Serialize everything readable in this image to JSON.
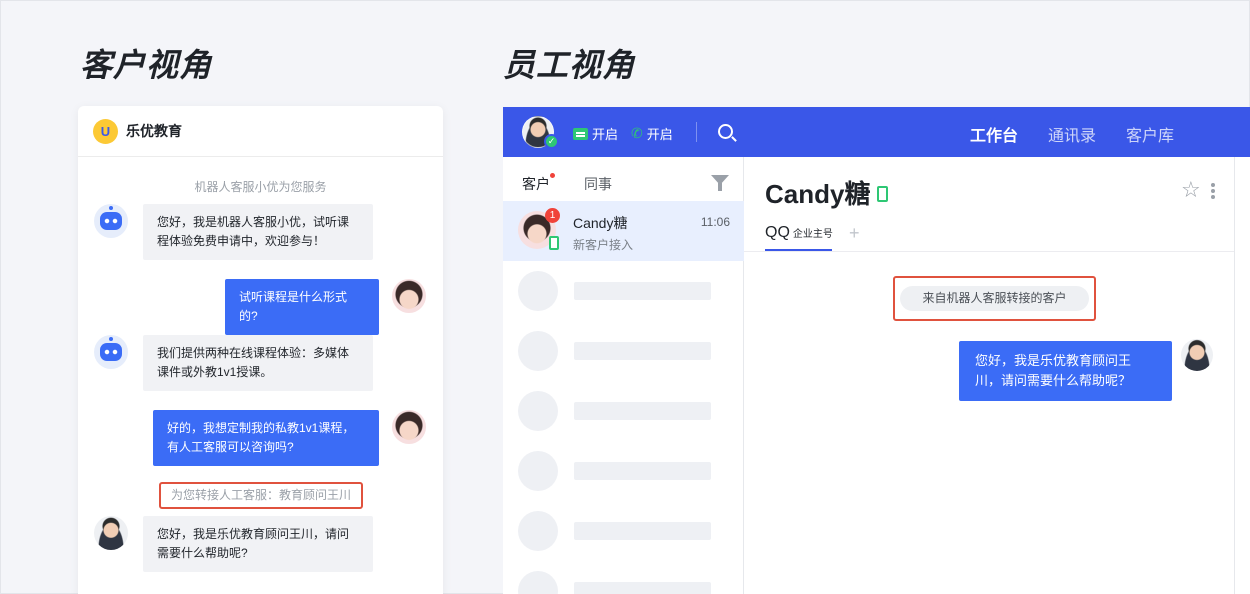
{
  "titles": {
    "customer_view": "客户视角",
    "staff_view": "员工视角"
  },
  "customer": {
    "brand_logo": "U",
    "brand_name": "乐优教育",
    "service_note": "机器人客服小优为您服务",
    "messages": [
      {
        "side": "left",
        "avatar": "robot-icon",
        "text": "您好，我是机器人客服小优，试听课程体验免费申请中，欢迎参与！"
      },
      {
        "side": "right",
        "avatar": "customer-avatar",
        "text": "试听课程是什么形式的?"
      },
      {
        "side": "left",
        "avatar": "robot-icon",
        "text": "我们提供两种在线课程体验：多媒体课件或外教1v1授课。"
      },
      {
        "side": "right",
        "avatar": "customer-avatar",
        "text": "好的，我想定制我的私教1v1课程，有人工客服可以咨询吗?"
      },
      {
        "side": "left",
        "avatar": "advisor-avatar",
        "text": "您好，我是乐优教育顾问王川，请问需要什么帮助呢?"
      }
    ],
    "transfer_note": "为您转接人工客服：教育顾问王川"
  },
  "staff": {
    "topbar": {
      "status_message": "开启",
      "status_phone": "开启",
      "nav": [
        "工作台",
        "通讯录",
        "客户库"
      ],
      "active_nav": 0
    },
    "list": {
      "tabs": [
        "客户",
        "同事"
      ],
      "active_tab": 0,
      "conversation": {
        "name": "Candy糖",
        "time": "11:06",
        "subtitle": "新客户接入",
        "badge": "1"
      },
      "placeholder_rows": 6
    },
    "chat": {
      "name": "Candy糖",
      "tab_label": "QQ",
      "tab_sub": "企业主号",
      "plus": "+",
      "system_note": "来自机器人客服转接的客户",
      "message": "您好，我是乐优教育顾问王川，请问需要什么帮助呢？"
    }
  },
  "colors": {
    "brand_blue": "#3a57e8",
    "bubble_blue": "#3b6cf6",
    "online_green": "#2ec774",
    "highlight_red": "#e0523e"
  }
}
